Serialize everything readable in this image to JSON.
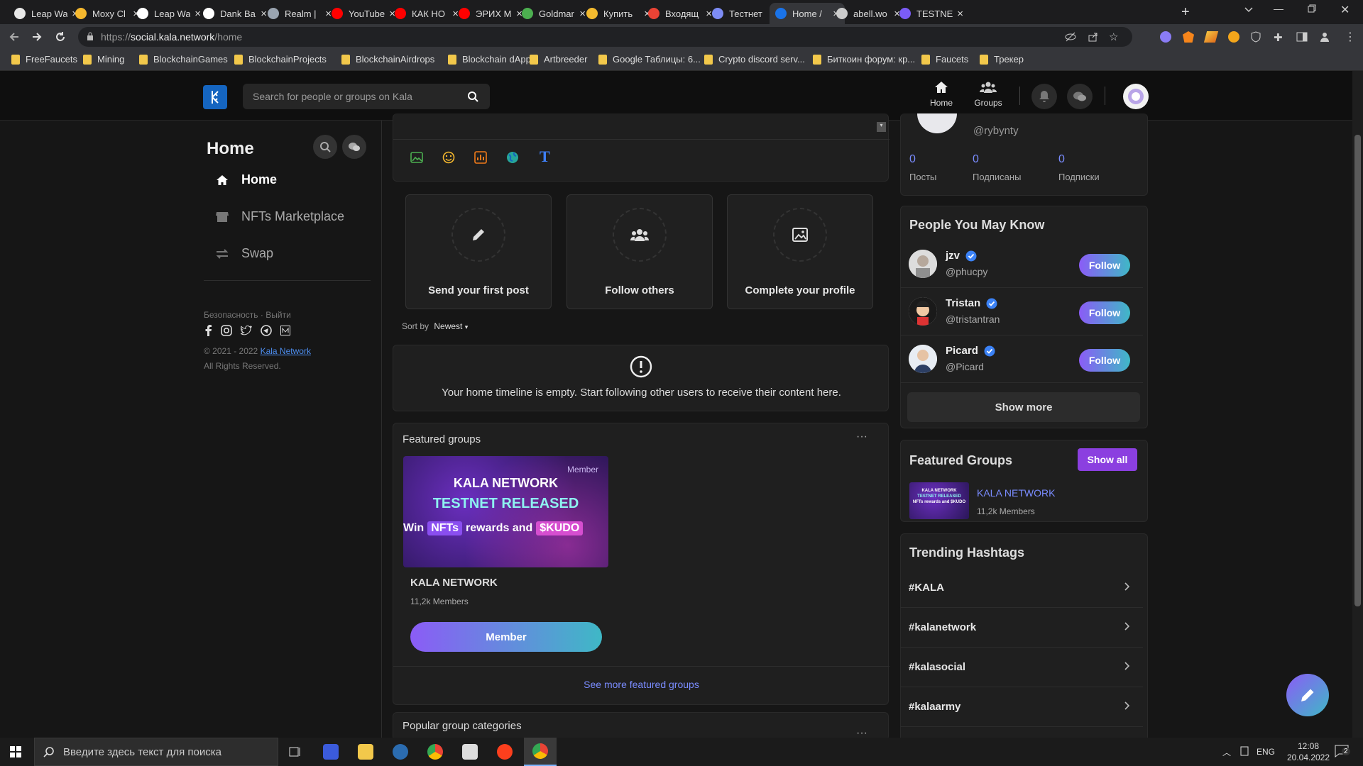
{
  "browser": {
    "tabs": [
      {
        "title": "Leap Wa",
        "color": "#e8e8e8"
      },
      {
        "title": "Moxy Cl",
        "color": "#f5b82e"
      },
      {
        "title": "Leap Wa",
        "color": "#ffffff"
      },
      {
        "title": "Dank Ba",
        "color": "#ffffff"
      },
      {
        "title": "Realm |",
        "color": "#9aa4b0"
      },
      {
        "title": "YouTube",
        "color": "#ff0000"
      },
      {
        "title": "КАК НО",
        "color": "#ff0000"
      },
      {
        "title": "ЭРИХ М",
        "color": "#ff0000"
      },
      {
        "title": "Goldmar",
        "color": "#4caf50"
      },
      {
        "title": "Купить",
        "color": "#f3ba2f"
      },
      {
        "title": "Входящ",
        "color": "#ea4335"
      },
      {
        "title": "Тестнет",
        "color": "#7d8cf5"
      },
      {
        "title": "Home /",
        "color": "#1a73e8"
      },
      {
        "title": "abell.wo",
        "color": "#cccccc"
      },
      {
        "title": "TESTNE",
        "color": "#7b5cf6"
      }
    ],
    "url_prefix": "https://",
    "url_host": "social.kala.network",
    "url_path": "/home",
    "bookmarks": [
      {
        "label": "FreeFaucets"
      },
      {
        "label": "Mining"
      },
      {
        "label": "BlockchainGames"
      },
      {
        "label": "BlockchainProjects"
      },
      {
        "label": "BlockchainAirdrops"
      },
      {
        "label": "Blockchain dApps"
      },
      {
        "label": "Artbreeder"
      },
      {
        "label": "Google Таблицы: 6..."
      },
      {
        "label": "Crypto discord serv..."
      },
      {
        "label": "Биткоин форум: кр..."
      },
      {
        "label": "Faucets"
      },
      {
        "label": "Трекер"
      }
    ]
  },
  "header": {
    "search_placeholder": "Search for people or groups on Kala",
    "nav_home": "Home",
    "nav_groups": "Groups"
  },
  "sidebar": {
    "title": "Home",
    "items": [
      {
        "label": "Home"
      },
      {
        "label": "NFTs Marketplace"
      },
      {
        "label": "Swap"
      }
    ],
    "links_safety": "Безопасность",
    "links_sep": "·",
    "links_logout": "Выйти",
    "copyright_prefix": "© 2021 - 2022",
    "copyright_link": "Kala Network",
    "rights": "All Rights Reserved."
  },
  "feed": {
    "steps": [
      {
        "label": "Send your first post"
      },
      {
        "label": "Follow others"
      },
      {
        "label": "Complete your profile"
      }
    ],
    "sort_by": "Sort by",
    "sort_value": "Newest",
    "empty_text": "Your home timeline is empty. Start following other users to receive their content here.",
    "featured_title": "Featured groups",
    "banner_line1": "KALA NETWORK",
    "banner_line2": "TESTNET RELEASED",
    "banner_line3a": "Win",
    "banner_nfts": "NFTs",
    "banner_line3b": "rewards and",
    "banner_kudo": "$KUDO",
    "banner_badge": "Member",
    "group_name": "KALA NETWORK",
    "group_members": "11,2k Members",
    "member_button": "Member",
    "see_more": "See more featured groups",
    "popular_title": "Popular group categories"
  },
  "profile": {
    "handle": "@rybynty",
    "stats": [
      {
        "value": "0",
        "label": "Посты"
      },
      {
        "value": "0",
        "label": "Подписаны"
      },
      {
        "value": "0",
        "label": "Подписки"
      }
    ]
  },
  "people": {
    "title": "People You May Know",
    "follow_label": "Follow",
    "users": [
      {
        "name": "jzv",
        "handle": "@phucpy"
      },
      {
        "name": "Tristan",
        "handle": "@tristantran"
      },
      {
        "name": "Picard",
        "handle": "@Picard"
      }
    ],
    "show_more": "Show more"
  },
  "featured_groups": {
    "title": "Featured Groups",
    "show_all": "Show all",
    "name": "KALA NETWORK",
    "members": "11,2k Members",
    "thumb_line1": "KALA NETWORK",
    "thumb_line2": "TESTNET RELEASED",
    "thumb_line3": "NFTs rewards and $KUDO"
  },
  "trending": {
    "title": "Trending Hashtags",
    "tags": [
      {
        "label": "#KALA"
      },
      {
        "label": "#kalanetwork"
      },
      {
        "label": "#kalasocial"
      },
      {
        "label": "#kalaarmy"
      }
    ]
  },
  "taskbar": {
    "search_placeholder": "Введите здесь текст для поиска",
    "lang": "ENG",
    "time": "12:08",
    "date": "20.04.2022",
    "notif_count": "2"
  },
  "colors": {
    "accent_purple": "#8b5cf6",
    "accent_teal": "#3fb8c6",
    "link_blue": "#7a8cff",
    "kala_blue": "#1565c0"
  }
}
